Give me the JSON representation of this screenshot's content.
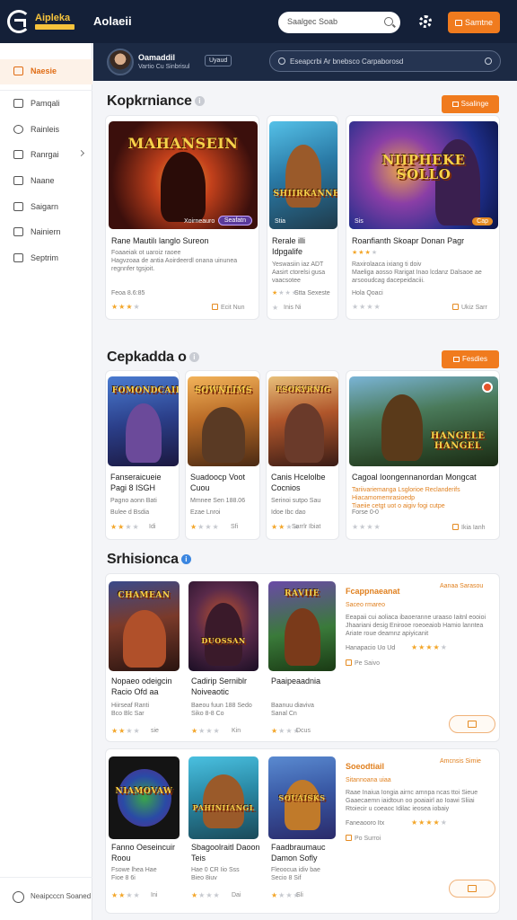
{
  "topbar": {
    "logo_text": "Aipleka",
    "app_title": "Aolaeii",
    "search_placeholder": "Saalgec Soab",
    "action_label": "Samtne"
  },
  "subbar": {
    "user_name": "Oamaddil",
    "user_sub": "Vartio Cu Sinbrisul",
    "user_tag": "Uyaud",
    "search_placeholder": "Eseapcrbi Ar bnebsco Carpaborosd"
  },
  "sidebar": {
    "items": [
      {
        "label": "Naesie",
        "icon": "grid-icon",
        "active": true
      },
      {
        "label": "Pamqali"
      },
      {
        "label": "Rainleis"
      },
      {
        "label": "Ranrgai"
      },
      {
        "label": "Naane"
      },
      {
        "label": "Saigarn"
      },
      {
        "label": "Nainiern"
      },
      {
        "label": "Septrim"
      }
    ],
    "footer": "Neaipcccn Soaned"
  },
  "sections": [
    {
      "title": "Kopkrniance",
      "button": "Ssalinge"
    },
    {
      "title": "Cepkadda o",
      "button": "Fesdies"
    },
    {
      "title": "Srhisionca"
    }
  ],
  "row1": [
    {
      "art_label": "MAHANSEIN",
      "art_meta": "Xoirneauro",
      "art_pill": "Seafatn",
      "title": "Rane Mautilı langlo Sureon",
      "desc": "Foaaeiak ot uaroiz raoee\nHagvzoaa de antia Aoirdeerdl onana uinunea regnnfer tgsjoit.",
      "extra": "Feoa 8.6:85",
      "rating": 3,
      "foot_icon_text": "Ecit",
      "foot_right": "Nun"
    },
    {
      "art_label": "SHIIRKANNE",
      "art_meta": "Stia",
      "title": "Rerale illi Idpgalife",
      "desc": "Yeswasiin iaz ADT Aasirt ctorelsi gusa vaacsotee",
      "extra": "Stta Sexeste",
      "rating": 1,
      "foot_right": "Inis Ni"
    },
    {
      "art_label": "NIIPHEKE SOLLO",
      "art_meta": "Sis",
      "art_badge": "Cap",
      "title": "Roanfianth Skoapr Donan Pagr",
      "desc": "Raxirolaaca ixiang ti doiv\nMaeliga aosso Rarigat Inao lcdanz Dalsaoe ae arsooudcag dacepeidaciii.",
      "extra": "Hola Qoaci",
      "rating": 0,
      "foot_icon_text": "Ukiz",
      "foot_right": "Sarr"
    }
  ],
  "row2": [
    {
      "art_label": "FOMONDCAIIE",
      "title": "Fanseraicueie Pagi 8 ISGH",
      "desc": "Pagno aonn Bati",
      "extra": "Bulee d Bsdia",
      "rating": 2,
      "foot_right": "Idi"
    },
    {
      "art_label": "SOWNLIMS",
      "title": "Suadoocp Voot Cuou",
      "desc": "Mmnee Sen 188.06",
      "extra": "Ezae Lnroi",
      "rating": 1,
      "foot_right": "Sfi"
    },
    {
      "art_label": "ESOKYRNIG",
      "title": "Canis Hcelolbe Cocnios",
      "desc": "Serinoi sutpo Sau",
      "extra": "Idoe Ibc dao",
      "rating": 2,
      "foot_right": "Sarrlr Ibiat"
    },
    {
      "art_label": "HANGELE HANGEL",
      "title": "Cagoal Ioongennanordan Mongcat",
      "desc": "Tariivariemanga Lsglorioe Reclanderifs Hiacamomemrasioedp\nTiaeiie cetgt uot o aigiv fogi cutpe",
      "extra": "Forse 0-0",
      "rating": 0,
      "foot_icon_text": "Ikia",
      "foot_right": "Ianh"
    }
  ],
  "row3": {
    "items": [
      {
        "art_label": "CHAMEAN",
        "title": "Nopaeo odeigcin Racio Ofd aa",
        "desc": "Hiirseaf Ranti\nBco Blc Sar",
        "rating": 2,
        "foot_right": "sie"
      },
      {
        "art_label": "DUOSSAN",
        "title": "Cadirip Serniblr Noiveaotic",
        "desc": "Baeou fuun 188 Sedo\nSiko 8-8 Co",
        "rating": 1,
        "foot_right": "Kin"
      },
      {
        "art_label": "RAVIIE",
        "title": "Paaipeaadnia",
        "desc": "Baanuu diaviva\nSanal Cn",
        "rating": 1,
        "foot_right": "Dcus"
      }
    ],
    "featured": {
      "title": "Fcappnaeanat",
      "tag": "Aanaa Sarasou",
      "sub": "Saceo rmareo",
      "desc": "Eeapaii cui aoliaca ibaoeranne uraaso Iaitnl eooioi Jhaariani desig Enirooe roeoeaiob Hamio lanntea Ariate roue deamnz apiyicanit",
      "rating_text": "Hanapacio Uo Ud",
      "rating": 4,
      "foot": "Pe Saivo"
    }
  },
  "row4": {
    "items": [
      {
        "art_label": "NIAMOVAW",
        "title": "Fanno Oeseincuir Roou",
        "desc": "Fsowe lhea Hae\nFioe 8 6i",
        "rating": 2,
        "foot_right": "Ini"
      },
      {
        "art_label": "PAHINIIANGL",
        "title": "Sbagoolraitl Daoon Teis",
        "desc": "Hae 0 CR Iio Sss\nBieo 8iuv",
        "rating": 1,
        "foot_right": "Dai"
      },
      {
        "art_label": "SOUAISKS",
        "title": "Faadbraumauc Damon Sofly",
        "desc": "Fleoocua idiv bae\nSecio 8 Sif",
        "rating": 1,
        "foot_right": "Sli"
      }
    ],
    "featured": {
      "title": "Soeodtiail",
      "tag": "Amcnsis Simie",
      "sub": "Sitannoana uiaa",
      "desc": "Raae Inaiua Iongia airnc amnpa ncas ttoi Sieue Gaaecaemn iaidtoun oo poaiairl ao Ioawi Sliiai Rtoiecir u coeaoc Idilac ieosea iobaiy",
      "rating_text": "Faneaooro Itx",
      "rating": 4,
      "foot": "Po Surroi"
    }
  },
  "colors": {
    "accent": "#f07b1e",
    "topbar": "#142038",
    "subbar": "#1c2a44",
    "star": "#f3a629"
  }
}
